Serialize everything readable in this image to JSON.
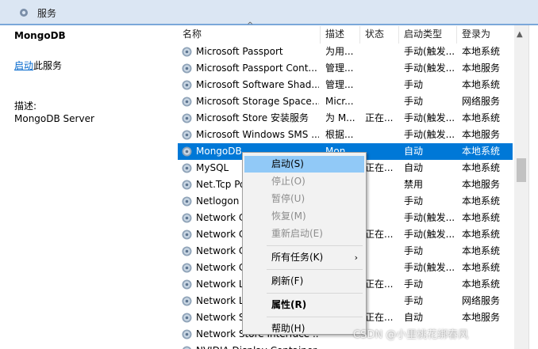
{
  "window": {
    "title": "服务"
  },
  "left_panel": {
    "service_name": "MongoDB",
    "start_link": "启动",
    "start_suffix": "此服务",
    "desc_label": "描述:",
    "desc_value": "MongoDB Server"
  },
  "columns": [
    "名称",
    "描述",
    "状态",
    "启动类型",
    "登录为"
  ],
  "rows": [
    {
      "name": "Microsoft Passport",
      "desc": "为用...",
      "status": "",
      "startup": "手动(触发...",
      "logon": "本地系统"
    },
    {
      "name": "Microsoft Passport Cont...",
      "desc": "管理...",
      "status": "",
      "startup": "手动(触发...",
      "logon": "本地服务"
    },
    {
      "name": "Microsoft Software Shad...",
      "desc": "管理...",
      "status": "",
      "startup": "手动",
      "logon": "本地系统"
    },
    {
      "name": "Microsoft Storage Space...",
      "desc": "Micr...",
      "status": "",
      "startup": "手动",
      "logon": "网络服务"
    },
    {
      "name": "Microsoft Store 安装服务",
      "desc": "为 M...",
      "status": "正在...",
      "startup": "手动(触发...",
      "logon": "本地系统"
    },
    {
      "name": "Microsoft Windows SMS ...",
      "desc": "根据...",
      "status": "",
      "startup": "手动(触发...",
      "logon": "本地服务"
    },
    {
      "name": "MongoDB",
      "desc": "Mon...",
      "status": "",
      "startup": "自动",
      "logon": "本地系统"
    },
    {
      "name": "MySQL",
      "desc": "",
      "status": "正在...",
      "startup": "自动",
      "logon": "本地系统"
    },
    {
      "name": "Net.Tcp Po",
      "desc": "",
      "status": "",
      "startup": "禁用",
      "logon": "本地服务"
    },
    {
      "name": "Netlogon",
      "desc": "",
      "status": "",
      "startup": "手动",
      "logon": "本地系统"
    },
    {
      "name": "Network C",
      "desc": "",
      "status": "",
      "startup": "手动(触发...",
      "logon": "本地系统"
    },
    {
      "name": "Network C",
      "desc": "",
      "status": "正在...",
      "startup": "手动(触发...",
      "logon": "本地系统"
    },
    {
      "name": "Network C",
      "desc": "",
      "status": "",
      "startup": "手动",
      "logon": "本地系统"
    },
    {
      "name": "Network C",
      "desc": "",
      "status": "",
      "startup": "手动(触发...",
      "logon": "本地系统"
    },
    {
      "name": "Network L",
      "desc": "",
      "status": "正在...",
      "startup": "手动",
      "logon": "本地系统"
    },
    {
      "name": "Network L",
      "desc": "",
      "status": "",
      "startup": "手动",
      "logon": "网络服务"
    },
    {
      "name": "Network S",
      "desc": "",
      "status": "正在...",
      "startup": "自动",
      "logon": "本地服务"
    },
    {
      "name": "Network Store Interface ...",
      "desc": "",
      "status": "",
      "startup": "",
      "logon": ""
    },
    {
      "name": "NVIDIA Display Container...",
      "desc": "",
      "status": "",
      "startup": "",
      "logon": ""
    }
  ],
  "selected_row": 6,
  "context_menu": [
    {
      "label": "启动(S)",
      "state": "highlight"
    },
    {
      "label": "停止(O)",
      "state": "disabled"
    },
    {
      "label": "暂停(U)",
      "state": "disabled"
    },
    {
      "label": "恢复(M)",
      "state": "disabled"
    },
    {
      "label": "重新启动(E)",
      "state": "disabled"
    },
    {
      "sep": true
    },
    {
      "label": "所有任务(K)",
      "state": "normal",
      "submenu": true
    },
    {
      "sep": true
    },
    {
      "label": "刷新(F)",
      "state": "normal"
    },
    {
      "sep": true
    },
    {
      "label": "属性(R)",
      "state": "bold"
    },
    {
      "sep": true
    },
    {
      "label": "帮助(H)",
      "state": "normal"
    }
  ],
  "submenu_arrow": "›",
  "sort_arrow": "^",
  "watermark": "CSDN @小里桃花绑春风",
  "colors": {
    "selection": "#0078d7",
    "menu_highlight": "#91c9f7",
    "link": "#0066cc",
    "titlebar": "#dbe6f3"
  }
}
